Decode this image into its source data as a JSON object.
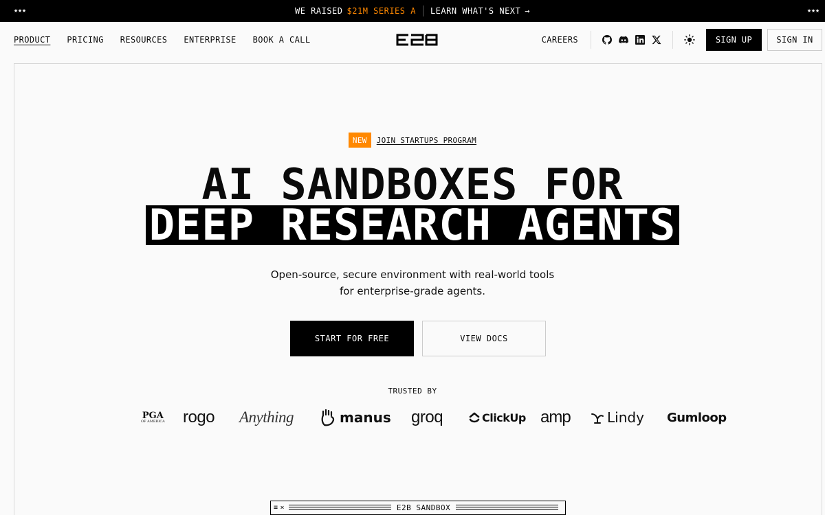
{
  "announcement": {
    "stars_left": "★★★",
    "stars_right": "★★★",
    "raised_prefix": "WE RAISED",
    "raised_highlight": "$21M SERIES A",
    "learn_more": "LEARN WHAT'S NEXT",
    "arrow": "→"
  },
  "nav": {
    "links": [
      "PRODUCT",
      "PRICING",
      "RESOURCES",
      "ENTERPRISE",
      "BOOK A CALL"
    ],
    "logo": "E2B",
    "careers": "CAREERS",
    "socials": [
      "github-icon",
      "discord-icon",
      "linkedin-icon",
      "x-icon"
    ],
    "theme_icon": "sun-icon",
    "sign_up": "SIGN UP",
    "sign_in": "SIGN IN"
  },
  "hero": {
    "badge_new": "NEW",
    "badge_link": "JOIN STARTUPS PROGRAM",
    "title_line1": "AI SANDBOXES FOR",
    "title_line2": "DEEP RESEARCH AGENTS",
    "subtitle_line1": "Open-source, secure environment with real-world tools",
    "subtitle_line2": "for enterprise-grade agents.",
    "cta_primary": "START FOR FREE",
    "cta_secondary": "VIEW DOCS"
  },
  "trusted": {
    "label": "TRUSTED BY",
    "logos": {
      "pga_main": "PGA",
      "pga_sub": "OF AMERICA",
      "rogo": "rogo",
      "anything": "Anything",
      "manus": "manus",
      "groq": "groq",
      "clickup": "ClickUp",
      "amp": "amp",
      "lindy": "Lindy",
      "gumloop": "Gumloop"
    }
  },
  "sandbox_window": {
    "title": "E2B SANDBOX",
    "controls": [
      "≡",
      "×"
    ]
  },
  "colors": {
    "accent": "#ff8800",
    "dark": "#000000",
    "background": "#fafafa"
  }
}
